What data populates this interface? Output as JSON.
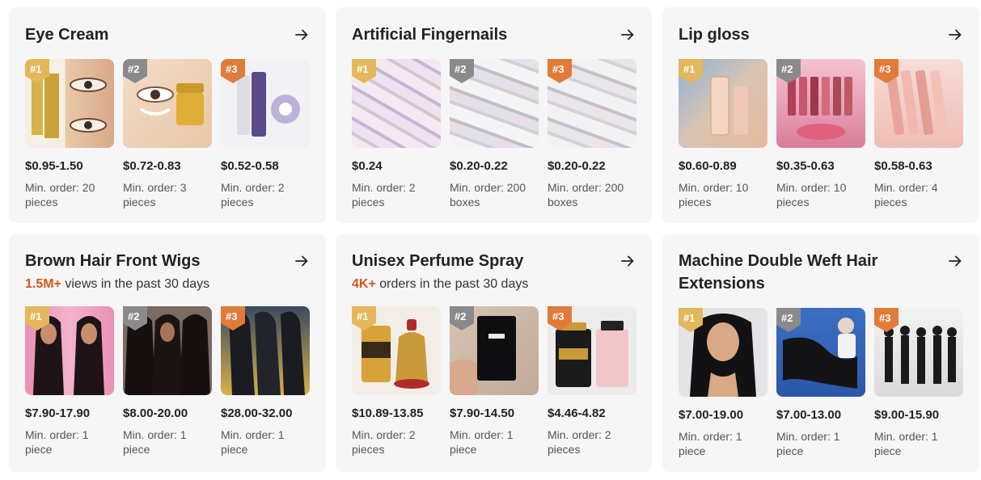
{
  "colors": {
    "card_bg": "#f6f6f6",
    "highlight": "#d9531e",
    "rank_1": "#e3b75b",
    "rank_2": "#8a8a8a",
    "rank_3": "#e07b3a"
  },
  "arrow_icon": "arrow-right-icon",
  "cards": [
    {
      "title": "Eye Cream",
      "products": [
        {
          "rank": "#1",
          "price": "$0.95-1.50",
          "moq": "Min. order: 20 pieces"
        },
        {
          "rank": "#2",
          "price": "$0.72-0.83",
          "moq": "Min. order: 3 pieces"
        },
        {
          "rank": "#3",
          "price": "$0.52-0.58",
          "moq": "Min. order: 2 pieces"
        }
      ]
    },
    {
      "title": "Artificial Fingernails",
      "products": [
        {
          "rank": "#1",
          "price": "$0.24",
          "moq": "Min. order: 2 pieces"
        },
        {
          "rank": "#2",
          "price": "$0.20-0.22",
          "moq": "Min. order: 200 boxes"
        },
        {
          "rank": "#3",
          "price": "$0.20-0.22",
          "moq": "Min. order: 200 boxes"
        }
      ]
    },
    {
      "title": "Lip gloss",
      "products": [
        {
          "rank": "#1",
          "price": "$0.60-0.89",
          "moq": "Min. order: 10 pieces"
        },
        {
          "rank": "#2",
          "price": "$0.35-0.63",
          "moq": "Min. order: 10 pieces"
        },
        {
          "rank": "#3",
          "price": "$0.58-0.63",
          "moq": "Min. order: 4 pieces"
        }
      ]
    },
    {
      "title": "Brown Hair Front Wigs",
      "stat_value": "1.5M+",
      "stat_text": " views in the past 30 days",
      "products": [
        {
          "rank": "#1",
          "price": "$7.90-17.90",
          "moq": "Min. order: 1 piece"
        },
        {
          "rank": "#2",
          "price": "$8.00-20.00",
          "moq": "Min. order: 1 piece"
        },
        {
          "rank": "#3",
          "price": "$28.00-32.00",
          "moq": "Min. order: 1 piece"
        }
      ]
    },
    {
      "title": "Unisex Perfume Spray",
      "stat_value": "4K+",
      "stat_text": " orders in the past 30 days",
      "products": [
        {
          "rank": "#1",
          "price": "$10.89-13.85",
          "moq": "Min. order: 2 pieces"
        },
        {
          "rank": "#2",
          "price": "$7.90-14.50",
          "moq": "Min. order: 1 piece"
        },
        {
          "rank": "#3",
          "price": "$4.46-4.82",
          "moq": "Min. order: 2 pieces"
        }
      ]
    },
    {
      "title": "Machine Double Weft Hair Extensions",
      "products": [
        {
          "rank": "#1",
          "price": "$7.00-19.00",
          "moq": "Min. order: 1 piece"
        },
        {
          "rank": "#2",
          "price": "$7.00-13.00",
          "moq": "Min. order: 1 piece"
        },
        {
          "rank": "#3",
          "price": "$9.00-15.90",
          "moq": "Min. order: 1 piece"
        }
      ]
    }
  ]
}
